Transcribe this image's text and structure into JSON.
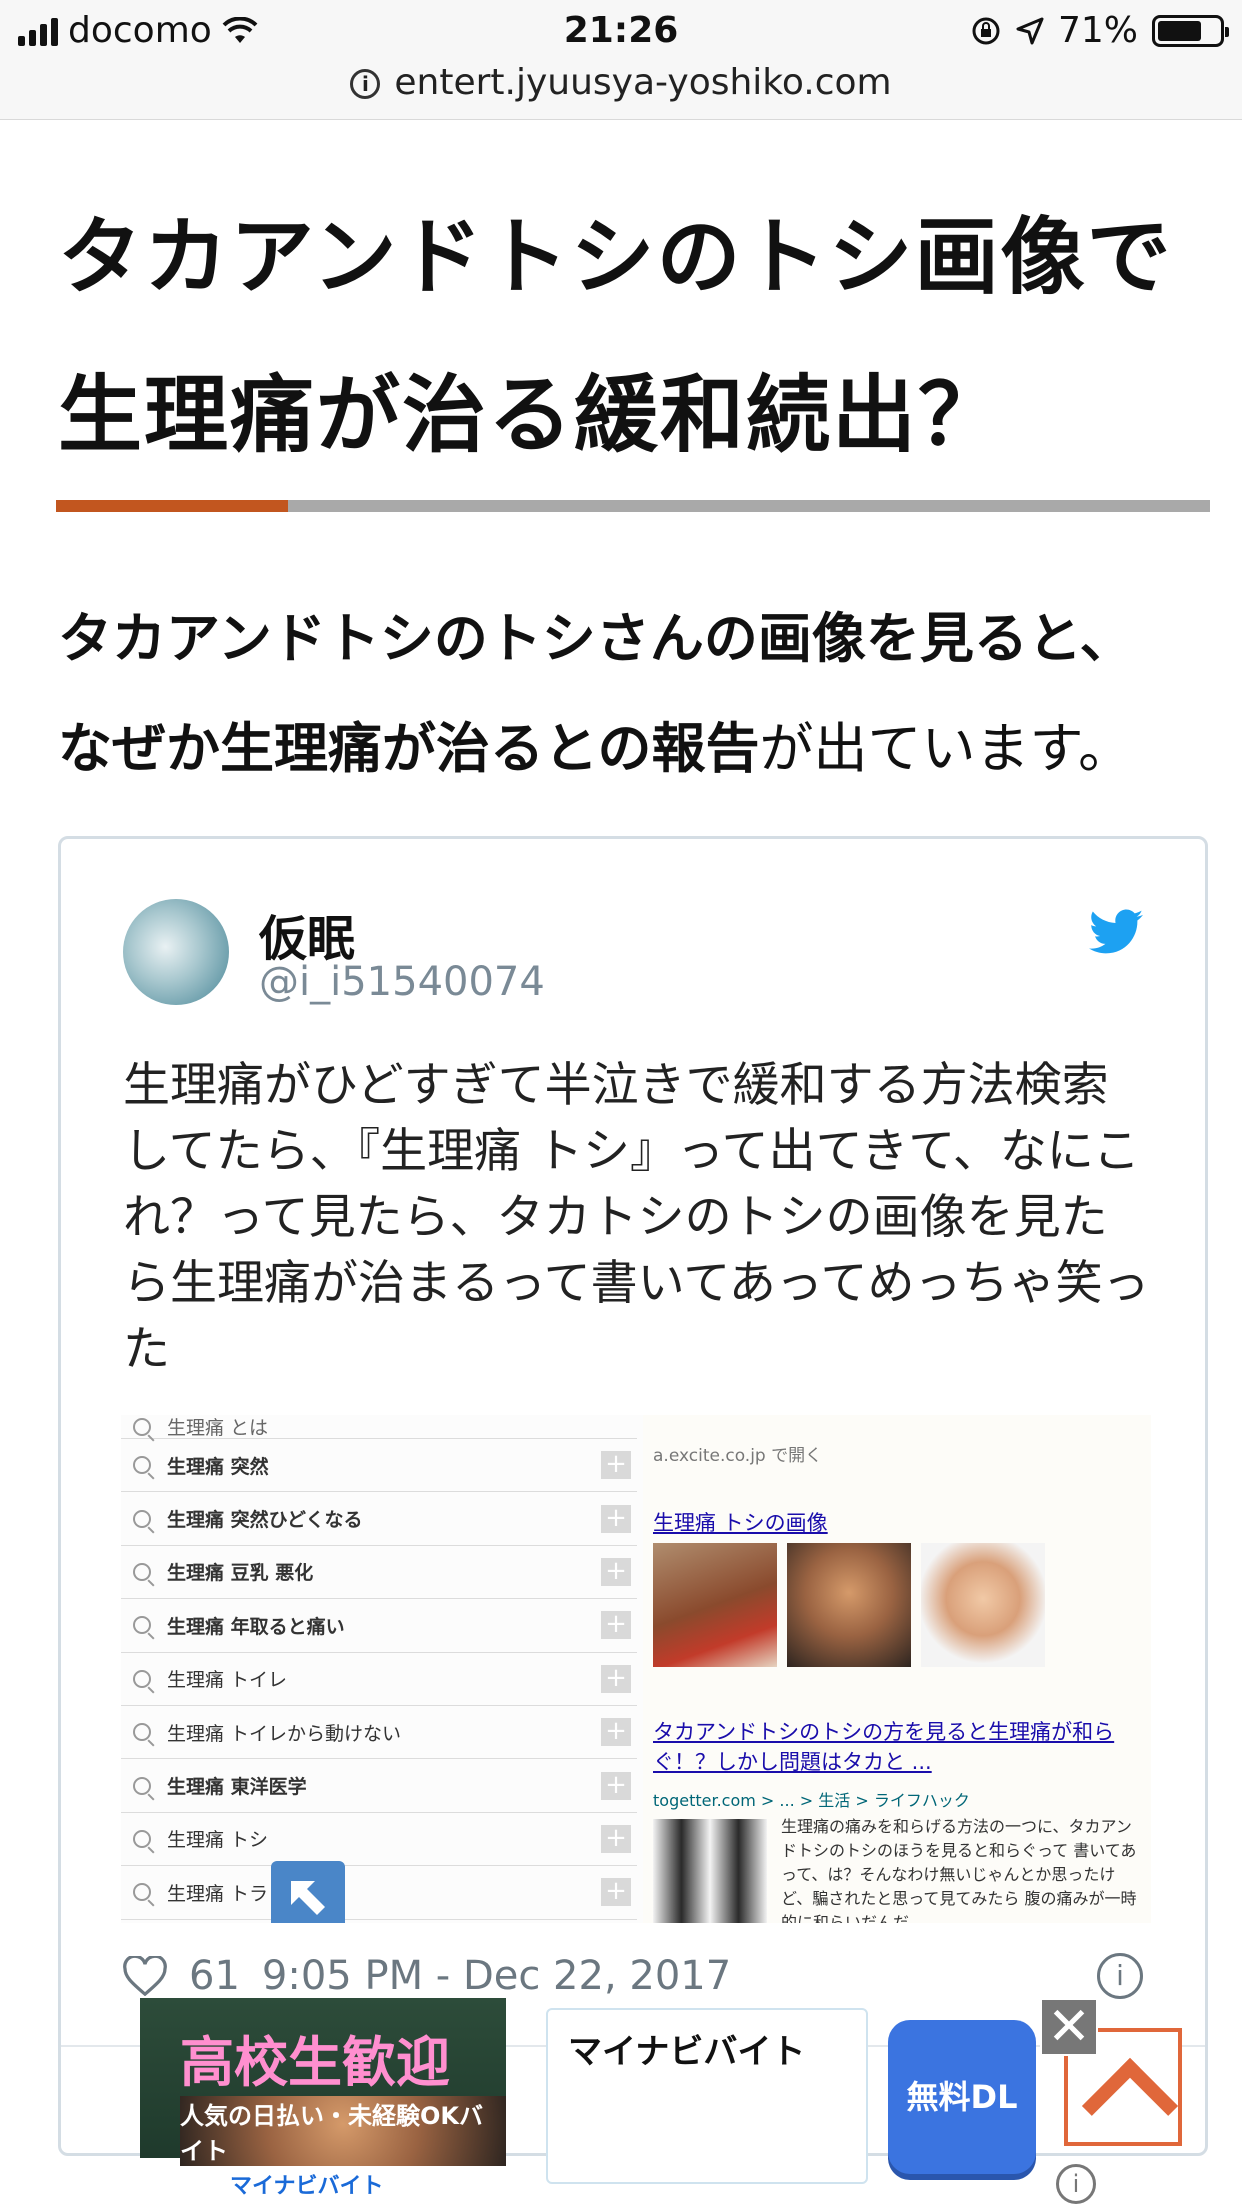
{
  "status_bar": {
    "carrier": "docomo",
    "time": "21:26",
    "battery": "71%"
  },
  "url_bar": {
    "domain": "entert.jyuusya-yoshiko.com"
  },
  "article": {
    "title_line1": "タカアンドトシのトシ画像で",
    "title_line2": "生理痛が治る緩和続出？",
    "lead_line1": "タカアンドトシのトシさんの画像を見ると、",
    "lead_line2_bold": "なぜか生理痛が治るとの報告",
    "lead_line2_rest": "が出ています。"
  },
  "tweet": {
    "name": "仮眠",
    "handle": "@i_i51540074",
    "text": "生理痛がひどすぎて半泣きで緩和する方法検索してたら、『生理痛 トシ』って出てきて、なにこれ？って見たら、タカトシのトシの画像を見たら生理痛が治まるって書いてあってめっちゃ笑った",
    "likes": "61",
    "timestamp": "9:05 PM - Dec 22, 2017",
    "media": {
      "suggestions": [
        "生理痛 とは",
        "生理痛 突然",
        "生理痛 突然ひどくなる",
        "生理痛 豆乳 悪化",
        "生理痛 年取ると痛い",
        "生理痛 トイレ",
        "生理痛 トイレから動けない",
        "生理痛 東洋医学",
        "生理痛 トシ",
        "生理痛 トラ"
      ],
      "open_in": "a.excite.co.jp で開く",
      "image_heading": "生理痛 トシの画像",
      "result_link": "タカアンドトシのトシの方を見ると生理痛が和らぐ！？しかし問題はタカと ...",
      "result_source": "togetter.com > ... > 生活 > ライフハック",
      "result_snippet": "生理痛の痛みを和らげる方法の一つに、タカアンドトシのトシのほうを見ると和らぐって 書いてあって、は？そんなわけ無いじゃんとか思ったけど、騙されたと思って見てみたら 腹の痛みが一時的に和らいだんだ"
    }
  },
  "ad": {
    "banner_title": "高校生歓迎",
    "banner_sub": "人気の日払い・未経験OKバイト",
    "brand": "マイナビバイト",
    "app_name": "マイナビバイト",
    "cta": "無料DL",
    "close": "✕",
    "info": "i"
  },
  "colors": {
    "title_accent": "#c2561f",
    "twitter_blue": "#1da1f2",
    "link_blue": "#1a0dab",
    "cta_blue": "#3b74e0"
  }
}
